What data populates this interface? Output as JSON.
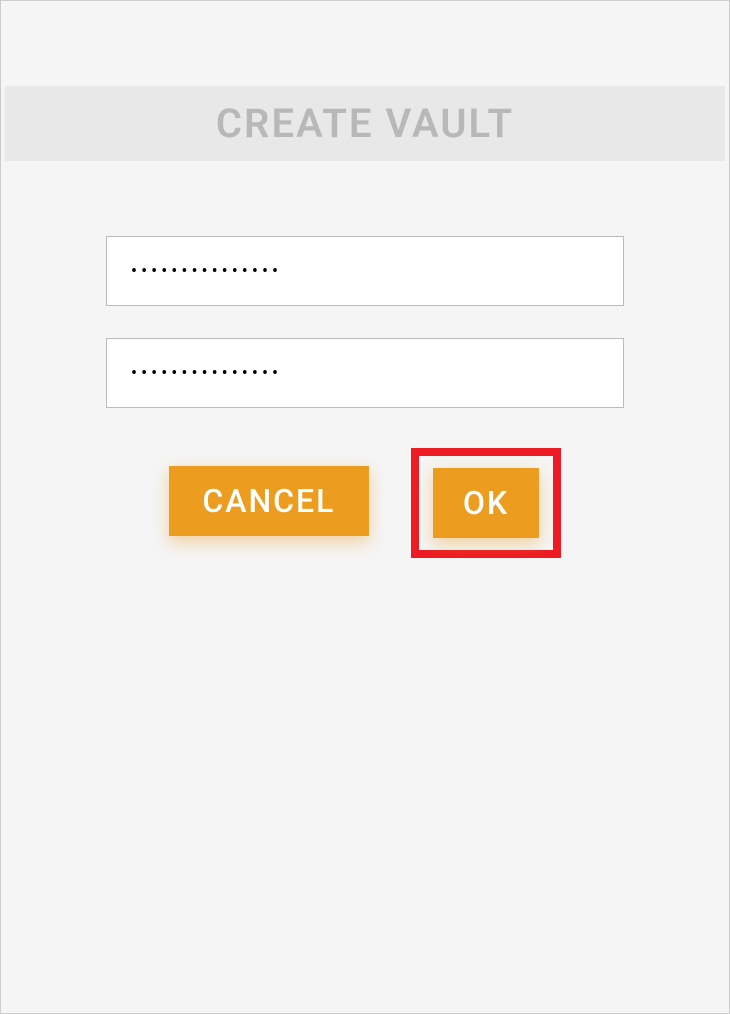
{
  "dialog": {
    "title": "CREATE VAULT",
    "password_value": "•••••••••••••••",
    "confirm_password_value": "•••••••••••••••",
    "buttons": {
      "cancel": "CANCEL",
      "ok": "OK"
    }
  },
  "colors": {
    "accent": "#ec9c1f",
    "highlight_border": "#ed1c24",
    "title_text": "#b8b8b8",
    "header_bg": "#e8e8e8"
  }
}
